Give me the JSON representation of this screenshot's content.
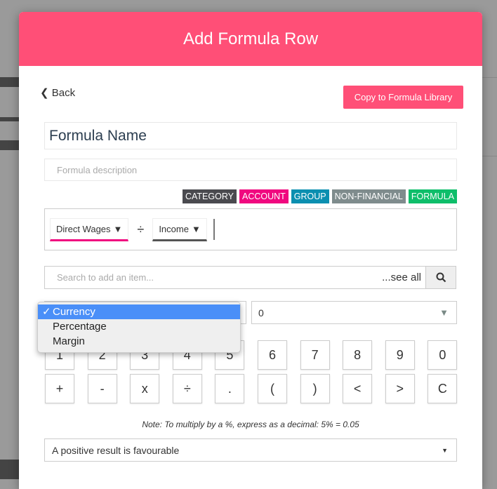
{
  "modal": {
    "title": "Add Formula Row",
    "back_label": "Back",
    "copy_label": "Copy to Formula Library",
    "name_value": "Formula Name",
    "description_placeholder": "Formula description",
    "tags": [
      {
        "label": "CATEGORY",
        "color": "#4a4a4f"
      },
      {
        "label": "ACCOUNT",
        "color": "#f0087f"
      },
      {
        "label": "GROUP",
        "color": "#0b8fb0"
      },
      {
        "label": "NON-FINANCIAL",
        "color": "#7f8c8d"
      },
      {
        "label": "FORMULA",
        "color": "#0ebe6a"
      }
    ],
    "formula": {
      "items": [
        {
          "label": "Direct Wages",
          "underline": "#f0087f"
        },
        {
          "operator": "÷"
        },
        {
          "label": "Income",
          "underline": "#555555"
        }
      ]
    },
    "search": {
      "placeholder": "Search to add an item...",
      "see_all": "...see all"
    },
    "format_dropdown": {
      "options": [
        "Currency",
        "Percentage",
        "Margin"
      ],
      "selected": "Currency"
    },
    "decimals_select": {
      "value": "0"
    },
    "keypad": [
      [
        "1",
        "2",
        "3",
        "4",
        "5",
        "6",
        "7",
        "8",
        "9",
        "0"
      ],
      [
        "+",
        "-",
        "x",
        "÷",
        ".",
        "(",
        ")",
        "<",
        ">",
        "C"
      ]
    ],
    "note": "Note: To multiply by a %, express as a decimal: 5% = 0.05",
    "favourable_select": {
      "value": "A positive result is favourable"
    }
  },
  "colors": {
    "accent": "#ff4f77"
  }
}
